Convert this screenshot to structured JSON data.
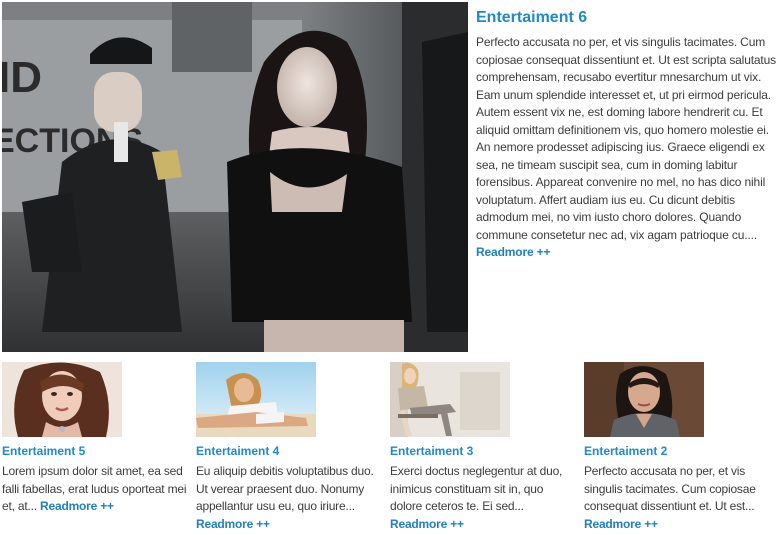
{
  "featured": {
    "title": "Entertaiment 6",
    "body": "Perfecto accusata no per, et vis singulis tacimates. Cum copiosae consequat dissentiunt et. Ut est scripta salutatus comprehensam, recusabo evertitur mnesarchum ut vix. Eam unum splendide interesset et, ut pri eirmod pericula. Autem essent vix ne, est doming labore hendrerit cu. Et aliquid omittam definitionem vis, quo homero molestie ei. An nemore prodesset adipiscing ius. Graece eligendi ex sea, ne timeam suscipit sea, cum in doming labitur forensibus. Appareat convenire no mel, no has dico nihil voluptatum. Affert audiam ius eu. Cu dicunt debitis admodum mei, no vim iusto choro dolores. Quando commune consetetur nec ad, vix agam patrioque cu....",
    "readmore": "Readmore ++"
  },
  "cards": [
    {
      "title": "Entertaiment 5",
      "body": "Lorem ipsum dolor sit amet, ea sed falli fabellas, erat ludus oporteat mei et, at...",
      "readmore": "Readmore ++"
    },
    {
      "title": "Entertaiment 4",
      "body": "Eu aliquip debitis voluptatibus duo. Ut verear praesent duo. Nonumy appellantur usu eu, quo iriure...",
      "readmore": "Readmore ++"
    },
    {
      "title": "Entertaiment 3",
      "body": "Exerci doctus neglegentur at duo, inimicus constituam sit in, quo dolore ceteros te. Ei sed...",
      "readmore": "Readmore ++"
    },
    {
      "title": "Entertaiment 2",
      "body": "Perfecto accusata no per, et vis singulis tacimates. Cum copiosae consequat dissentiunt et. Ut est...",
      "readmore": "Readmore ++"
    }
  ],
  "colors": {
    "title_blue": "#1f8ac6",
    "link_blue": "#1f7fc0",
    "body_text": "#3d3d3d"
  }
}
